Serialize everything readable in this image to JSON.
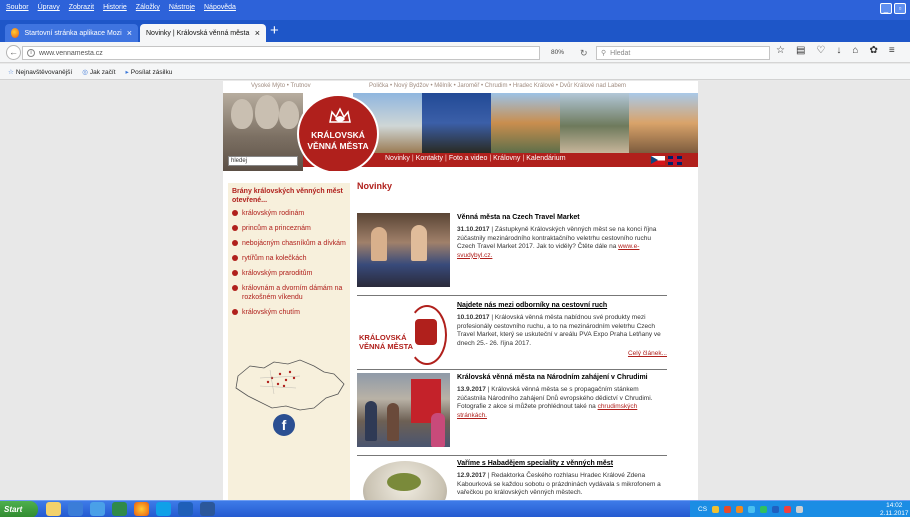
{
  "menu": [
    "Soubor",
    "Úpravy",
    "Zobrazit",
    "Historie",
    "Záložky",
    "Nástroje",
    "Nápověda"
  ],
  "tabs": [
    {
      "label": "Startovní stránka aplikace Mozi",
      "close": "×"
    },
    {
      "label": "Novinky | Královská věnná města",
      "close": "×"
    }
  ],
  "new_tab": "+",
  "nav": {
    "url": "www.vennamesta.cz",
    "zoom": "80%",
    "search_placeholder": "Hledat"
  },
  "bookmarks": [
    "Nejnavštěvovanější",
    "Jak začít",
    "Posílat zásilku"
  ],
  "site": {
    "topnav_left": "Vysoké Mýto • Trutnov",
    "topnav_right": "Polička • Nový Bydžov • Mělník • Jaroměř • Chrudim • Hradec Králové • Dvůr Králové nad Labem",
    "logo_line1": "KRÁLOVSKÁ",
    "logo_line2": "VĚNNÁ MĚSTA",
    "search_value": "hledej",
    "main_nav": [
      "Novinky",
      "Kontakty",
      "Foto a video",
      "Královny",
      "Kalendárium"
    ],
    "main_nav_sep": "|",
    "page_title": "Novinky"
  },
  "sidebar": {
    "heading": "Brány královských věnných měst otevřené...",
    "items": [
      "královským rodinám",
      "princům a princeznám",
      "nebojácným chasníkům a dívkám",
      "rytířům na kolečkách",
      "královským praroditům",
      "královnám a dvorním dámám na rozkošném víkendu",
      "královským chutím"
    ],
    "fb_letter": "f"
  },
  "articles": [
    {
      "title": "Věnná města na Czech Travel Market",
      "date": "31.10.2017",
      "text": " | Zástupkyně Královských věnných měst se na konci října zúčastnily mezinárodního kontraktačního veletrhu cestovního ruchu Czech Travel Market 2017. Jak to viděly? Čtěte dále na ",
      "link": "www.e-svudybyl.cz."
    },
    {
      "title": "Najdete nás mezi odborníky na cestovní ruch",
      "date": "10.10.2017",
      "text": " | Královská věnná  města nabídnou své produkty mezi profesionály cestovního ruchu, a to na mezinárodním veletrhu Czech Travel Market, který se uskuteční v areálu PVA Expo Praha Letňany ve dnech 25.- 26. října 2017.",
      "thumb_line1": "KRÁLOVSKÁ",
      "thumb_line2": "VĚNNÁ MĚSTA",
      "more": "Celý článek..."
    },
    {
      "title": "Královská věnná města na Národním zahájení v Chrudimi",
      "date": "13.9.2017",
      "text": " | Královská věnná města se s propagačním stánkem zúčastnila Národního zahájení Dnů evropského dědictví v Chrudimi. Fotografie z akce si můžete prohlédnout také na ",
      "link": "chrudimských stránkách."
    },
    {
      "title": "Vaříme s Habadějem speciality z věnných měst",
      "date": "12.9.2017",
      "text": " | Redaktorka Českého rozhlasu Hradec Králové Zdena Kabourková se každou sobotu o prázdninách vydávala s mikrofonem a vařečkou po královských věnných městech."
    }
  ],
  "taskbar": {
    "start": "Start",
    "lang": "CS",
    "time": "14:02",
    "date": "2.11.2017"
  },
  "colors": {
    "brand_red": "#b0201c",
    "titlebar_blue": "#2d62d9",
    "sidebar_bg": "#f7f0dc"
  }
}
